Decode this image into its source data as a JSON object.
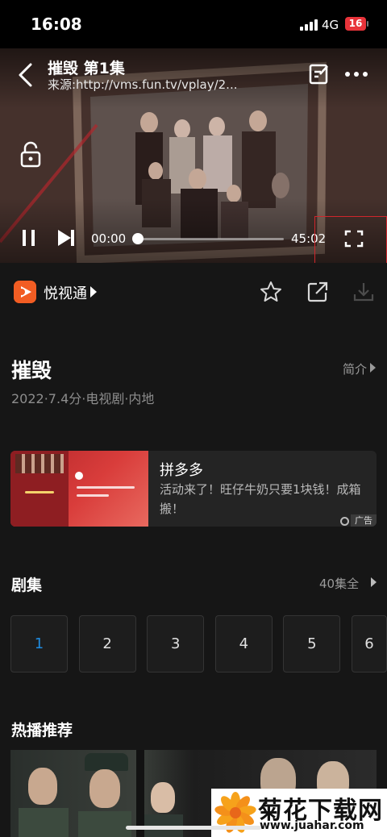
{
  "status_bar": {
    "time": "16:08",
    "network": "4G",
    "battery": "16"
  },
  "player": {
    "title": "摧毁 第1集",
    "source": "来源:http://vms.fun.tv/vplay/2...",
    "current_time": "00:00",
    "total_time": "45:02",
    "progress": 0
  },
  "source_row": {
    "app_name": "悦视通"
  },
  "show": {
    "title": "摧毁",
    "meta": "2022·7.4分·电视剧·内地",
    "intro_label": "简介"
  },
  "ad": {
    "name": "拼多多",
    "text": "活动来了！旺仔牛奶只要1块钱！成箱搬！",
    "badge": "广告"
  },
  "episodes": {
    "title": "剧集",
    "count_label": "40集全",
    "items": [
      "1",
      "2",
      "3",
      "4",
      "5",
      "6"
    ],
    "selected": "1"
  },
  "recommend": {
    "title": "热播推荐"
  },
  "watermark": {
    "title": "菊花下载网",
    "url": "www.juahar.com"
  },
  "colors": {
    "accent": "#1e8be0",
    "background": "#161616",
    "ad_red": "#d93d3b",
    "highlight": "#d0262c"
  },
  "icons": [
    "back-arrow",
    "edit-note",
    "more-dots",
    "unlock",
    "pause",
    "skip-next",
    "fullscreen",
    "star",
    "share",
    "download"
  ]
}
